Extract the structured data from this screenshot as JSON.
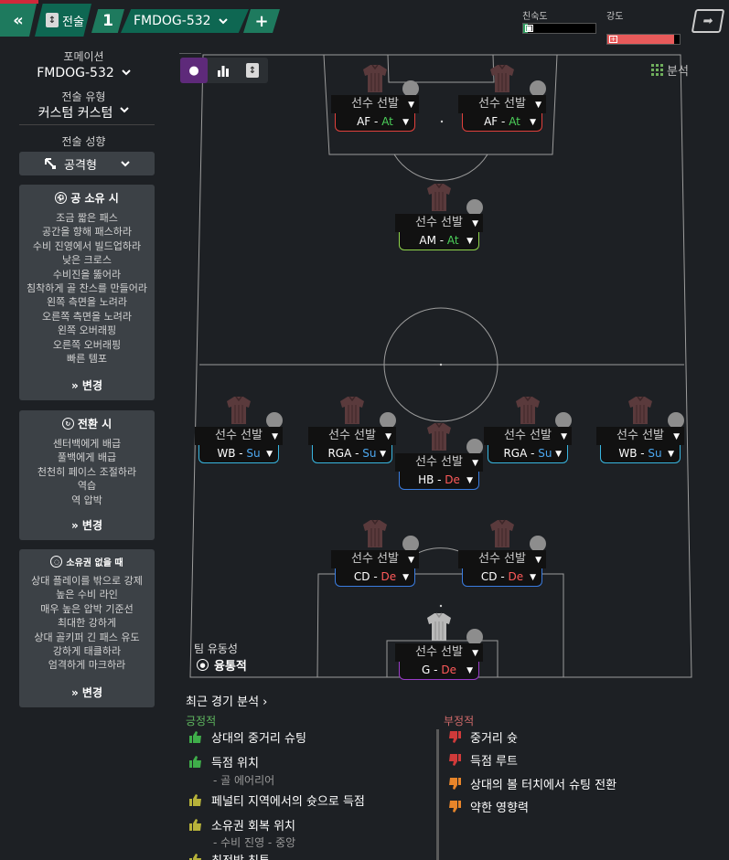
{
  "topbar": {
    "back_label": "«",
    "tactic_label": "전술",
    "tactic_slot": "1",
    "formation_name": "FMDOG-532",
    "add_label": "+",
    "familiarity_label": "친숙도",
    "intensity_label": "강도",
    "familiarity_level": 0.06,
    "intensity_level": 0.92,
    "colors": {
      "familiarity": "#2ea060",
      "intensity": "#e85a5a"
    }
  },
  "sidebar": {
    "formation_label": "포메이션",
    "formation_value": "FMDOG-532",
    "tactic_type_label": "전술 유형",
    "tactic_type_value": "커스텀 커스텀",
    "mentality_label": "전술 성향",
    "mentality_value": "공격형",
    "in_possession": {
      "title": "공 소유 시",
      "items": [
        "조금 짧은 패스",
        "공간을 향해 패스하라",
        "수비 진영에서 빌드업하라",
        "낮은 크로스",
        "수비진을 뚫어라",
        "침착하게 골 찬스를 만들어라",
        "왼쪽 측면을 노려라",
        "오른쪽 측면을 노려라",
        "왼쪽 오버래핑",
        "오른쪽 오버래핑",
        "빠른 템포"
      ],
      "change": "변경"
    },
    "in_transition": {
      "title": "전환 시",
      "items": [
        "센터백에게 배급",
        "풀백에게 배급",
        "천천히 페이스 조절하라",
        "역습",
        "역 압박"
      ],
      "change": "변경"
    },
    "out_of_possession": {
      "title": "소유권 없을 때",
      "items": [
        "상대 플레이를 밖으로 강제",
        "높은 수비 라인",
        "매우 높은 압박 기준선",
        "최대한 강하게",
        "상대 골키퍼 긴 패스 유도",
        "강하게 태클하라",
        "엄격하게 마크하라"
      ],
      "change": "변경"
    }
  },
  "pitch": {
    "analysis_label": "분석",
    "fluidity_label": "팀 유동성",
    "fluidity_value": "융통적",
    "players": [
      {
        "label": "선수 선발",
        "role": "AF",
        "duty": "At",
        "shirt": "red",
        "line": "#e0403c"
      },
      {
        "label": "선수 선발",
        "role": "AF",
        "duty": "At",
        "shirt": "red",
        "line": "#e0403c"
      },
      {
        "label": "선수 선발",
        "role": "AM",
        "duty": "At",
        "shirt": "red",
        "line": "#8fd44a"
      },
      {
        "label": "선수 선발",
        "role": "WB",
        "duty": "Su",
        "shirt": "red",
        "line": "#38b6e0"
      },
      {
        "label": "선수 선발",
        "role": "RGA",
        "duty": "Su",
        "shirt": "red",
        "line": "#38b6e0"
      },
      {
        "label": "선수 선발",
        "role": "HB",
        "duty": "De",
        "shirt": "red",
        "line": "#3a7ce0"
      },
      {
        "label": "선수 선발",
        "role": "RGA",
        "duty": "Su",
        "shirt": "red",
        "line": "#38b6e0"
      },
      {
        "label": "선수 선발",
        "role": "WB",
        "duty": "Su",
        "shirt": "red",
        "line": "#38b6e0"
      },
      {
        "label": "선수 선발",
        "role": "CD",
        "duty": "De",
        "shirt": "red",
        "line": "#3a7ce0"
      },
      {
        "label": "선수 선발",
        "role": "CD",
        "duty": "De",
        "shirt": "red",
        "line": "#3a7ce0"
      },
      {
        "label": "선수 선발",
        "role": "G",
        "duty": "De",
        "shirt": "grey",
        "line": "#9a3cc8"
      }
    ],
    "duty_colors": {
      "At": "#4cd05a",
      "Su": "#4da8f0",
      "De": "#ff5a5a"
    }
  },
  "analysis": {
    "title": "최근 경기 분석",
    "positive_label": "긍정적",
    "negative_label": "부정적",
    "positives": [
      {
        "text": "상대의 중거리 슈팅",
        "sub": "",
        "color": "#3fae4a"
      },
      {
        "text": "득점 위치",
        "sub": "- 골 에어리어",
        "color": "#3fae4a"
      },
      {
        "text": "페널티 지역에서의 슛으로 득점",
        "sub": "",
        "color": "#b7b23a"
      },
      {
        "text": "소유권 회복 위치",
        "sub": "- 수비 진영 - 중앙",
        "color": "#b7b23a"
      },
      {
        "text": "최전방 침투",
        "sub": "",
        "color": "#b7b23a"
      }
    ],
    "negatives": [
      {
        "text": "중거리 슛",
        "color": "#d03a3a"
      },
      {
        "text": "득점 루트",
        "color": "#d03a3a"
      },
      {
        "text": "상대의 볼 터치에서 슈팅 전환",
        "color": "#e8852a"
      },
      {
        "text": "약한 영향력",
        "color": "#e8852a"
      }
    ]
  }
}
